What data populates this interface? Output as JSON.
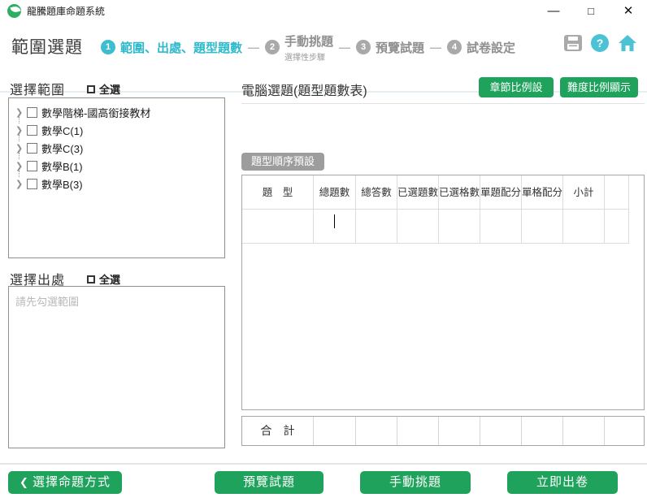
{
  "window": {
    "title": "龍騰題庫命題系統",
    "controls": {
      "minimize": "—",
      "maximize": "□",
      "close": "✕"
    }
  },
  "header": {
    "page_title": "範圍選題",
    "separator": "—",
    "steps": [
      {
        "num": "1",
        "label": "範圍、出處、題型題數",
        "sublabel": ""
      },
      {
        "num": "2",
        "label": "手動挑題",
        "sublabel": "選擇性步驟"
      },
      {
        "num": "3",
        "label": "預覽試題",
        "sublabel": ""
      },
      {
        "num": "4",
        "label": "試卷設定",
        "sublabel": ""
      }
    ],
    "icons": {
      "save": "save-icon",
      "help": "?",
      "home": "home-icon"
    }
  },
  "left": {
    "range_section": {
      "title": "選擇範圍",
      "select_all_label": "全選",
      "chevron": "❯",
      "items": [
        "數學階梯-國高銜接教材",
        "數學C(1)",
        "數學C(3)",
        "數學B(1)",
        "數學B(3)"
      ]
    },
    "source_section": {
      "title": "選擇出處",
      "select_all_label": "全選",
      "placeholder": "請先勾選範圍"
    }
  },
  "main": {
    "title": "電腦選題(題型題數表)",
    "chapter_ratio_button": "章節比例設定",
    "difficulty_ratio_button": "難度比例顯示",
    "preset_tab": "題型順序預設",
    "table": {
      "headers": [
        "題　型",
        "總題數",
        "總答數",
        "已選題數",
        "已選格數",
        "單題配分",
        "單格配分",
        "小計",
        ""
      ],
      "rows": [
        [
          "",
          "",
          "",
          "",
          "",
          "",
          "",
          "",
          ""
        ]
      ],
      "total_label": "合　計"
    }
  },
  "footer": {
    "back_chevron": "❮",
    "back_button": "選擇命題方式",
    "preview_button": "預覽試題",
    "manual_button": "手動挑題",
    "generate_button": "立即出卷"
  },
  "colors": {
    "accent_green": "#1fa35c",
    "accent_teal": "#3ebdd0",
    "inactive_gray": "#a9a9a9"
  }
}
